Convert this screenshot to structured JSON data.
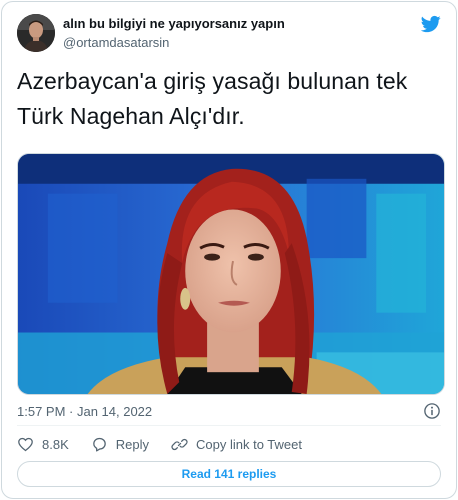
{
  "author": {
    "display_name": "alın bu bilgiyi ne yapıyorsanız yapın",
    "handle": "@ortamdasatarsin"
  },
  "icons": {
    "platform": "twitter-bird-icon",
    "info": "info-icon",
    "like": "heart-icon",
    "reply": "reply-bubble-icon",
    "copy": "link-icon"
  },
  "tweet": {
    "line1": "Azerbaycan'a giriş yasağı bulunan tek",
    "line2": "Türk Nagehan Alçı'dır.",
    "timestamp": "1:57 PM · Jan 14, 2022"
  },
  "actions": {
    "likes": "8.8K",
    "reply_label": "Reply",
    "copy_label": "Copy link to Tweet"
  },
  "replies_button": "Read 141 replies",
  "colors": {
    "accent": "#1d9bf0",
    "text": "#0f1419",
    "muted": "#536471",
    "border": "#cfd9de"
  }
}
